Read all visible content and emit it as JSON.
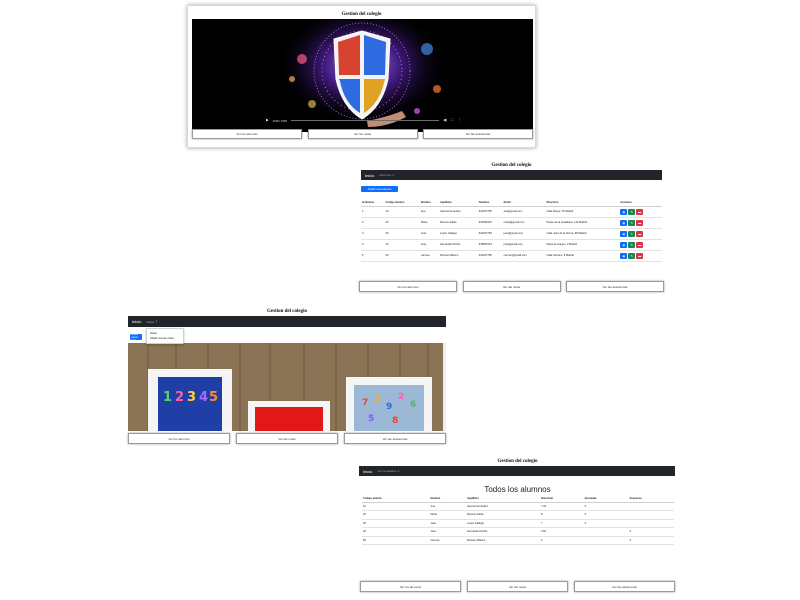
{
  "site_title": "Gestion del colegio",
  "footer_buttons": [
    "Ver los alumnos",
    "Ver las notas",
    "Ver las asistencias"
  ],
  "video_view": {
    "time": "0:00 / 0:50",
    "progress": 0.0,
    "colors": {
      "background": "#000000"
    }
  },
  "table_view": {
    "navbar": {
      "brand": "Inicio",
      "menu": "Alumnos"
    },
    "add_button": "Añadir nuevo alumno",
    "columns": [
      "Id alumno",
      "Codigo alumno",
      "Nombre",
      "Apellidos",
      "Telefono",
      "Email",
      "Direccion",
      "Acciones"
    ],
    "rows": [
      [
        "1",
        "10",
        "Ana",
        "Garcia Fernandez",
        "604327765",
        "ana@gmail.com",
        "Calle Mayor, 25 Madrid"
      ],
      [
        "2",
        "20",
        "Maria",
        "Moreno Arillas",
        "678452315",
        "maria@gmail.com",
        "Paseo de la castellana, 142 Madrid"
      ],
      [
        "3",
        "30",
        "Juan",
        "Lopez Gallego",
        "604327759",
        "juan@gmail.com",
        "Calle Juan de la Cierva, 98 Madrid"
      ],
      [
        "4",
        "40",
        "Jose",
        "Hernandez Rubio",
        "678905134",
        "jose@gmail.com",
        "Plaza de Aragon, 2 Madrid"
      ],
      [
        "5",
        "50",
        "Carmen",
        "Montero Blanco",
        "604327758",
        "carmen@gmail.com",
        "Calle Serrano, 8 Madrid"
      ]
    ],
    "action_icons": [
      "eye-icon",
      "pencil-icon",
      "trash-icon"
    ],
    "colors": {
      "view": "#0d6efd",
      "edit": "#198754",
      "delete": "#dc3545",
      "navbar": "#212529"
    }
  },
  "notas_view": {
    "navbar": {
      "brand": "Inicio",
      "menu": "Notas"
    },
    "dropdown_items": [
      "Notas",
      "Añadir nuevas notas"
    ],
    "hidden_button": "Añadir nueva nota"
  },
  "todos_view": {
    "navbar": {
      "brand": "Inicio",
      "menu": "Ver resultados"
    },
    "heading": "Todos los alumnos",
    "columns": [
      "Codigo alumno",
      "Nombre",
      "Apellidos",
      "Nota final",
      "Aprobado",
      "Suspenso"
    ],
    "rows": [
      [
        "10",
        "Ana",
        "Garcia Fernandez",
        "7.33",
        "X",
        ""
      ],
      [
        "20",
        "Maria",
        "Moreno Arillas",
        "8",
        "X",
        ""
      ],
      [
        "30",
        "Juan",
        "Lopez Gallego",
        "7",
        "X",
        ""
      ],
      [
        "40",
        "Jose",
        "Hernandez Rubio",
        "3.66",
        "",
        "X"
      ],
      [
        "50",
        "Carmen",
        "Montero Blanco",
        "4",
        "",
        "X"
      ]
    ]
  }
}
